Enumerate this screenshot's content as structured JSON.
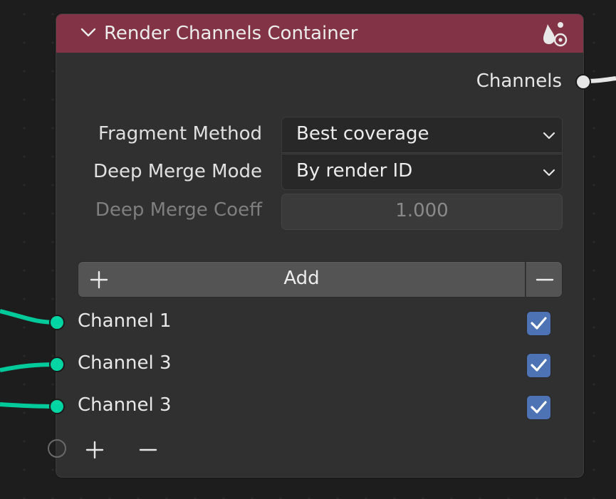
{
  "node": {
    "title": "Render Channels Container",
    "collapse_icon": "chevron-down-icon",
    "type_icon": "render-channel-icon",
    "header_color": "#823345"
  },
  "output": {
    "label": "Channels",
    "socket_color": "#e6e6e6"
  },
  "properties": {
    "fragment_method": {
      "label": "Fragment Method",
      "value": "Best coverage"
    },
    "deep_merge_mode": {
      "label": "Deep Merge Mode",
      "value": "By render ID"
    },
    "deep_merge_coeff": {
      "label": "Deep Merge Coeff",
      "value": "1.000"
    }
  },
  "list_controls": {
    "add_label": "Add",
    "add_icon": "plus-icon",
    "remove_icon": "minus-icon"
  },
  "channels": [
    {
      "label": "Channel 1",
      "enabled": true
    },
    {
      "label": "Channel 3",
      "enabled": true
    },
    {
      "label": "Channel 3",
      "enabled": true
    }
  ],
  "socket_controls": {
    "add_icon": "plus-icon",
    "remove_icon": "minus-icon"
  },
  "colors": {
    "input_socket": "#00d6a3",
    "checkbox": "#4d73b5"
  }
}
